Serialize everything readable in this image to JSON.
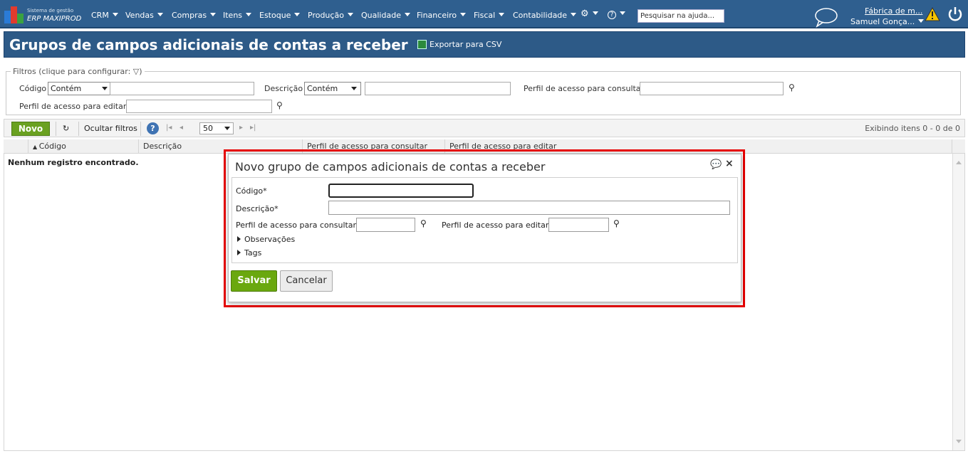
{
  "header": {
    "brand_line1": "Sistema de gestão",
    "brand_line2": "ERP MAXIPROD",
    "menu": [
      "CRM",
      "Vendas",
      "Compras",
      "Itens",
      "Estoque",
      "Produção",
      "Qualidade",
      "Financeiro",
      "Fiscal",
      "Contabilidade"
    ],
    "help_search_placeholder": "Pesquisar na ajuda...",
    "company": "Fábrica de m...",
    "user": "Samuel Gonça..."
  },
  "page": {
    "title": "Grupos de campos adicionais de contas a receber",
    "export_label": "Exportar para CSV"
  },
  "filters": {
    "legend": "Filtros (clique para configurar:",
    "codigo_label": "Código",
    "codigo_mode": "Contém",
    "descricao_label": "Descrição",
    "descricao_mode": "Contém",
    "perfil_consultar_label": "Perfil de acesso para consultar",
    "perfil_editar_label": "Perfil de acesso para editar"
  },
  "toolbar": {
    "new_label": "Novo",
    "hide_filters_label": "Ocultar filtros",
    "page_size": "50",
    "display_info": "Exibindo itens 0 - 0 de 0"
  },
  "grid": {
    "columns": [
      "Código",
      "Descrição",
      "Perfil de acesso para consultar",
      "Perfil de acesso para editar"
    ],
    "empty_message": "Nenhum registro encontrado."
  },
  "dialog": {
    "title": "Novo grupo de campos adicionais de contas a receber",
    "codigo_label": "Código*",
    "descricao_label": "Descrição*",
    "perfil_consultar_label": "Perfil de acesso para consultar",
    "perfil_editar_label": "Perfil de acesso para editar",
    "observacoes_label": "Observações",
    "tags_label": "Tags",
    "save_label": "Salvar",
    "cancel_label": "Cancelar"
  },
  "colors": {
    "nav_bg": "#2f5f8f",
    "title_bg": "#2d5a87",
    "primary_button": "#6aa80f",
    "highlight": "#e60000"
  }
}
